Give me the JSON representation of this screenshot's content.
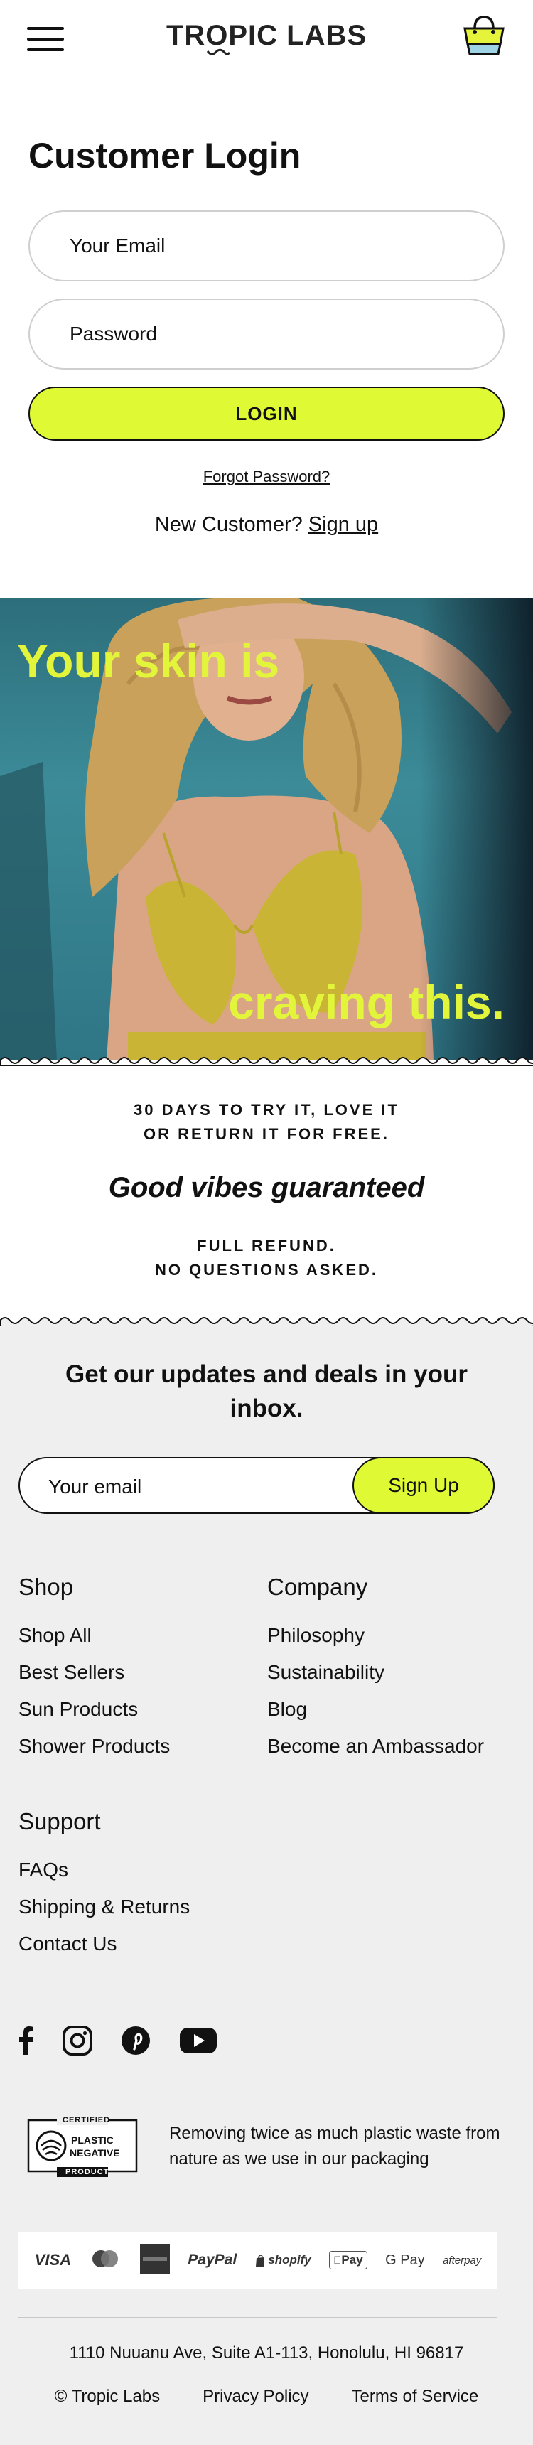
{
  "header": {
    "logo": "TROPIC LABS",
    "menu_icon": "hamburger-menu-icon",
    "cart_icon": "shopping-bag-icon"
  },
  "login": {
    "title": "Customer Login",
    "email_placeholder": "Your Email",
    "password_placeholder": "Password",
    "login_button": "LOGIN",
    "forgot_password": "Forgot Password?",
    "new_customer_text": "New Customer?",
    "signup_link": "Sign up"
  },
  "hero": {
    "line1": "Your skin is",
    "line2": "craving this."
  },
  "guarantee": {
    "line1": "30 DAYS TO TRY IT, LOVE IT",
    "line2": "OR RETURN IT FOR FREE.",
    "headline": "Good vibes guaranteed",
    "line3": "FULL REFUND.",
    "line4": "NO QUESTIONS ASKED."
  },
  "newsletter": {
    "title": "Get our updates and deals in your inbox.",
    "email_placeholder": "Your email",
    "button": "Sign Up"
  },
  "footer_nav": {
    "shop": {
      "title": "Shop",
      "items": [
        "Shop All",
        "Best Sellers",
        "Sun Products",
        "Shower Products"
      ]
    },
    "company": {
      "title": "Company",
      "items": [
        "Philosophy",
        "Sustainability",
        "Blog",
        "Become an Ambassador"
      ]
    },
    "support": {
      "title": "Support",
      "items": [
        "FAQs",
        "Shipping & Returns",
        "Contact Us"
      ]
    }
  },
  "social_icons": [
    "facebook-icon",
    "instagram-icon",
    "pinterest-icon",
    "youtube-icon"
  ],
  "badge": {
    "top": "CERTIFIED",
    "line1": "PLASTIC",
    "line2": "NEGATIVE",
    "bottom": "PRODUCT",
    "text": "Removing twice as much plastic waste from nature as we use in our packaging"
  },
  "payments": [
    "VISA",
    "Mastercard",
    "American Express",
    "PayPal",
    "shopify",
    "Pay",
    "G Pay",
    "afterpay"
  ],
  "address": "1110 Nuuanu Ave, Suite A1-113, Honolulu, HI 96817",
  "legal": {
    "copyright": "© Tropic Labs",
    "privacy": "Privacy Policy",
    "terms": "Terms of Service"
  },
  "colors": {
    "accent": "#dffa35",
    "hero_text": "#e2f53a",
    "footer_bg": "#efefef"
  }
}
